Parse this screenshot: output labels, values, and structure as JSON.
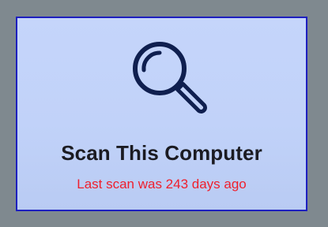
{
  "scan_tile": {
    "icon": "magnifier-icon",
    "title": "Scan This Computer",
    "status": "Last scan was 243 days ago"
  },
  "colors": {
    "background": "#7f898f",
    "tile_fill": "#c3d4f9",
    "tile_border": "#1d1fbf",
    "title_text": "#1b1b22",
    "status_text": "#ef1f2c",
    "icon_stroke": "#0f1f4f"
  }
}
